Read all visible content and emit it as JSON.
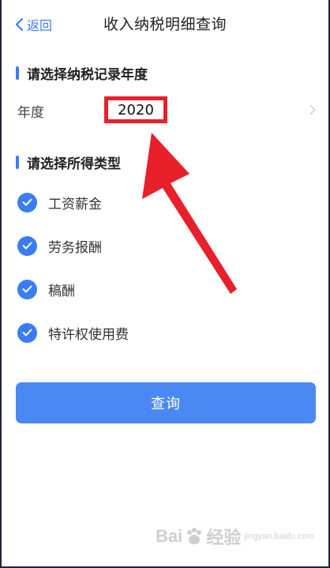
{
  "header": {
    "back_label": "返回",
    "title": "收入纳税明细查询"
  },
  "year_section": {
    "title": "请选择纳税记录年度",
    "label": "年度",
    "value": "2020"
  },
  "income_section": {
    "title": "请选择所得类型",
    "items": [
      {
        "label": "工资薪金",
        "checked": true
      },
      {
        "label": "劳务报酬",
        "checked": true
      },
      {
        "label": "稿酬",
        "checked": true
      },
      {
        "label": "特许权使用费",
        "checked": true
      }
    ]
  },
  "query_button": {
    "label": "查询"
  },
  "watermark": {
    "text_left": "Bai",
    "text_right": "经验",
    "sub": "jingyan.baidu.com"
  },
  "colors": {
    "accent": "#3b7cf4",
    "button": "#4a89f3",
    "highlight": "#e8202a"
  }
}
